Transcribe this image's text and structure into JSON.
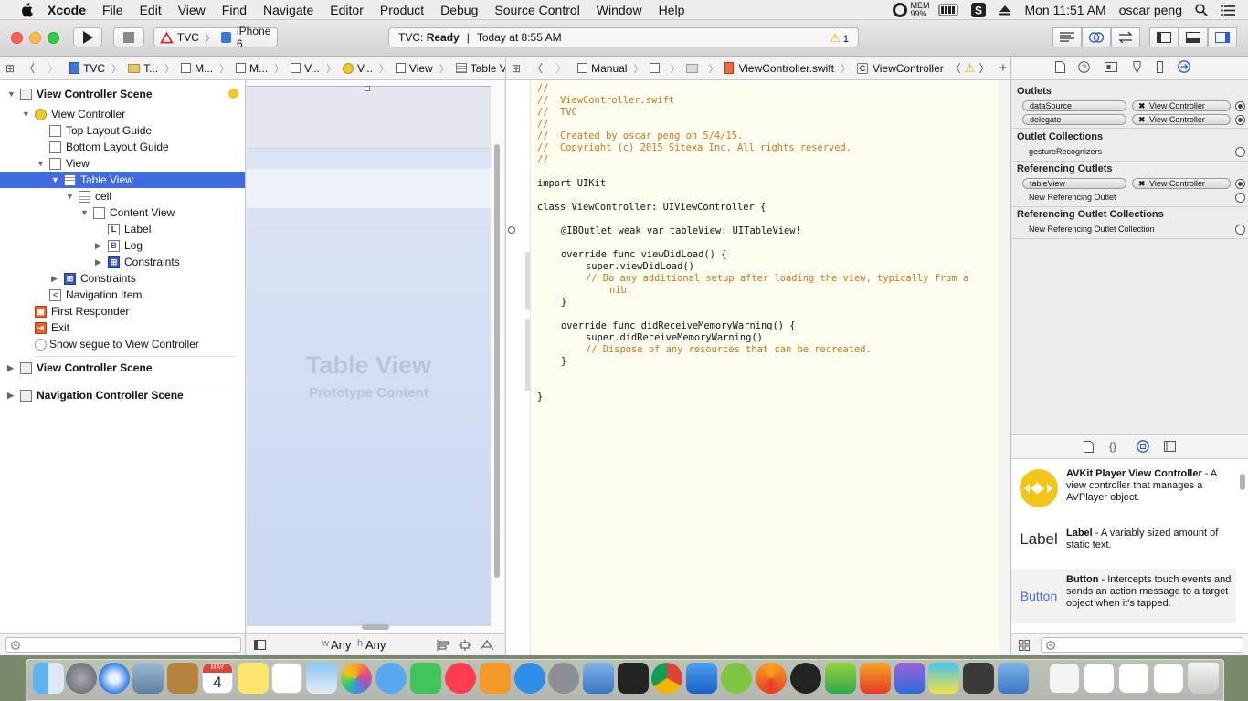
{
  "menubar": {
    "app": "Xcode",
    "items": [
      "File",
      "Edit",
      "View",
      "Find",
      "Navigate",
      "Editor",
      "Product",
      "Debug",
      "Source Control",
      "Window",
      "Help"
    ],
    "mem_label": "MEM",
    "mem_value": "99%",
    "clock": "Mon 11:51 AM",
    "user": "oscar peng"
  },
  "toolbar": {
    "scheme_target": "TVC",
    "scheme_device": "iPhone 6",
    "activity_project": "TVC:",
    "activity_status": "Ready",
    "activity_separator": "|",
    "activity_time": "Today at 8:55 AM",
    "warning_count": "1"
  },
  "jumpbar_left": {
    "items": [
      "TVC",
      "T...",
      "M...",
      "M...",
      "V...",
      "V...",
      "View",
      "Table View"
    ]
  },
  "jumpbar_right": {
    "mode": "Manual",
    "file": "ViewController.swift",
    "symbol": "ViewController"
  },
  "navigator": {
    "rows": [
      {
        "label": "View Controller Scene"
      },
      {
        "label": "View Controller"
      },
      {
        "label": "Top Layout Guide"
      },
      {
        "label": "Bottom Layout Guide"
      },
      {
        "label": "View"
      },
      {
        "label": "Table View"
      },
      {
        "label": "cell"
      },
      {
        "label": "Content View"
      },
      {
        "label": "Label"
      },
      {
        "label": "Log"
      },
      {
        "label": "Constraints"
      },
      {
        "label": "Constraints"
      },
      {
        "label": "Navigation Item"
      },
      {
        "label": "First Responder"
      },
      {
        "label": "Exit"
      },
      {
        "label": "Show segue to View Controller"
      },
      {
        "label": "View Controller Scene"
      },
      {
        "label": "Navigation Controller Scene"
      }
    ]
  },
  "canvas": {
    "title": "Table View",
    "subtitle": "Prototype Content",
    "size_w_prefix": "w",
    "size_w": "Any",
    "size_h_prefix": "h",
    "size_h": "Any"
  },
  "editor": {
    "lines": [
      "//",
      "//  ViewController.swift",
      "//  TVC",
      "//",
      "//  Created by oscar peng on 5/4/15.",
      "//  Copyright (c) 2015 Sitexa Inc. All rights reserved.",
      "//",
      "import UIKit",
      "class ViewController: UIViewController {",
      "@IBOutlet weak var tableView: UITableView!",
      "override func viewDidLoad() {",
      "super.viewDidLoad()",
      "// Do any additional setup after loading the view, typically from a",
      "nib.",
      "}",
      "override func didReceiveMemoryWarning() {",
      "super.didReceiveMemoryWarning()",
      "// Dispose of any resources that can be recreated.",
      "}",
      "}"
    ]
  },
  "inspector": {
    "outlets_header": "Outlets",
    "outlets": [
      {
        "name": "dataSource",
        "target": "View Controller"
      },
      {
        "name": "delegate",
        "target": "View Controller"
      }
    ],
    "outlet_collections_header": "Outlet Collections",
    "outlet_collections": [
      "gestureRecognizers"
    ],
    "referencing_outlets_header": "Referencing Outlets",
    "referencing_outlets": [
      {
        "name": "tableView",
        "target": "View Controller"
      }
    ],
    "new_referencing_outlet": "New Referencing Outlet",
    "referencing_collections_header": "Referencing Outlet Collections",
    "new_referencing_collection": "New Referencing Outlet Collection"
  },
  "library": {
    "items": [
      {
        "name": "AVKit Player View Controller",
        "desc": " - A view controller that manages a AVPlayer object.",
        "preview": ""
      },
      {
        "name": "Label",
        "desc": " - A variably sized amount of static text.",
        "preview": "Label"
      },
      {
        "name": "Button",
        "desc": " - Intercepts touch events and sends an action message to a target object when it's tapped.",
        "preview": "Button"
      }
    ]
  },
  "dock": {
    "calendar_month": "MAY",
    "calendar_day": "4"
  },
  "colors": {
    "selection": "#3f6de1",
    "comment": "#c8771c",
    "keyword": "#a626a4",
    "type": "#d84a16",
    "warning": "#e0b000"
  }
}
